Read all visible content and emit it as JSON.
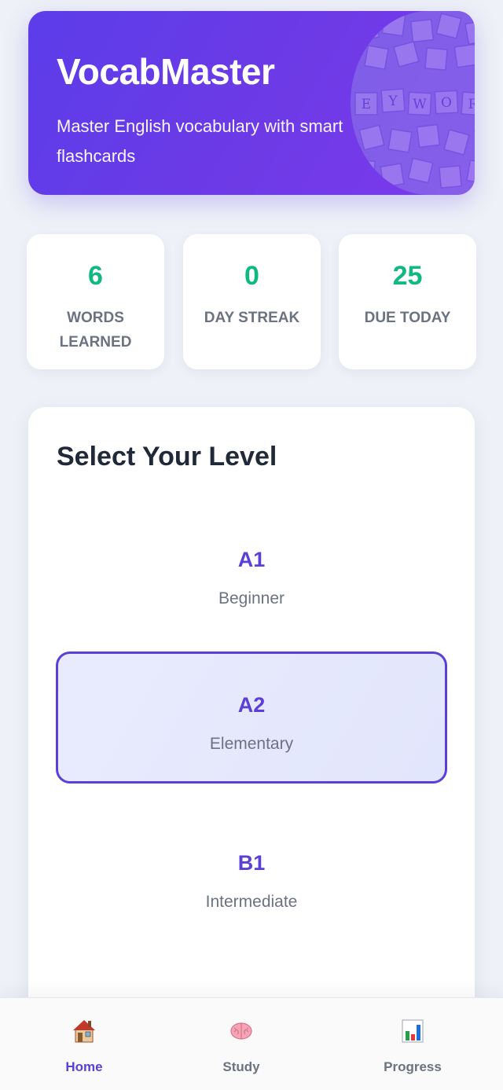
{
  "hero": {
    "title": "VocabMaster",
    "subtitle": "Master English vocabulary with smart flashcards"
  },
  "stats": [
    {
      "value": "6",
      "label": "Words Learned"
    },
    {
      "value": "0",
      "label": "Day Streak"
    },
    {
      "value": "25",
      "label": "Due Today"
    }
  ],
  "level_section": {
    "title": "Select Your Level",
    "options": [
      {
        "code": "A1",
        "description": "Beginner",
        "selected": false
      },
      {
        "code": "A2",
        "description": "Elementary",
        "selected": true
      },
      {
        "code": "B1",
        "description": "Intermediate",
        "selected": false
      }
    ]
  },
  "nav": {
    "items": [
      {
        "label": "Home",
        "icon": "house-icon",
        "active": true
      },
      {
        "label": "Study",
        "icon": "brain-icon",
        "active": false
      },
      {
        "label": "Progress",
        "icon": "bar-chart-icon",
        "active": false
      }
    ]
  },
  "colors": {
    "brand": "#5b3fd8",
    "stat_value": "#10b981",
    "hero_gradient_start": "#5b3de9",
    "hero_gradient_end": "#7c3aed"
  }
}
